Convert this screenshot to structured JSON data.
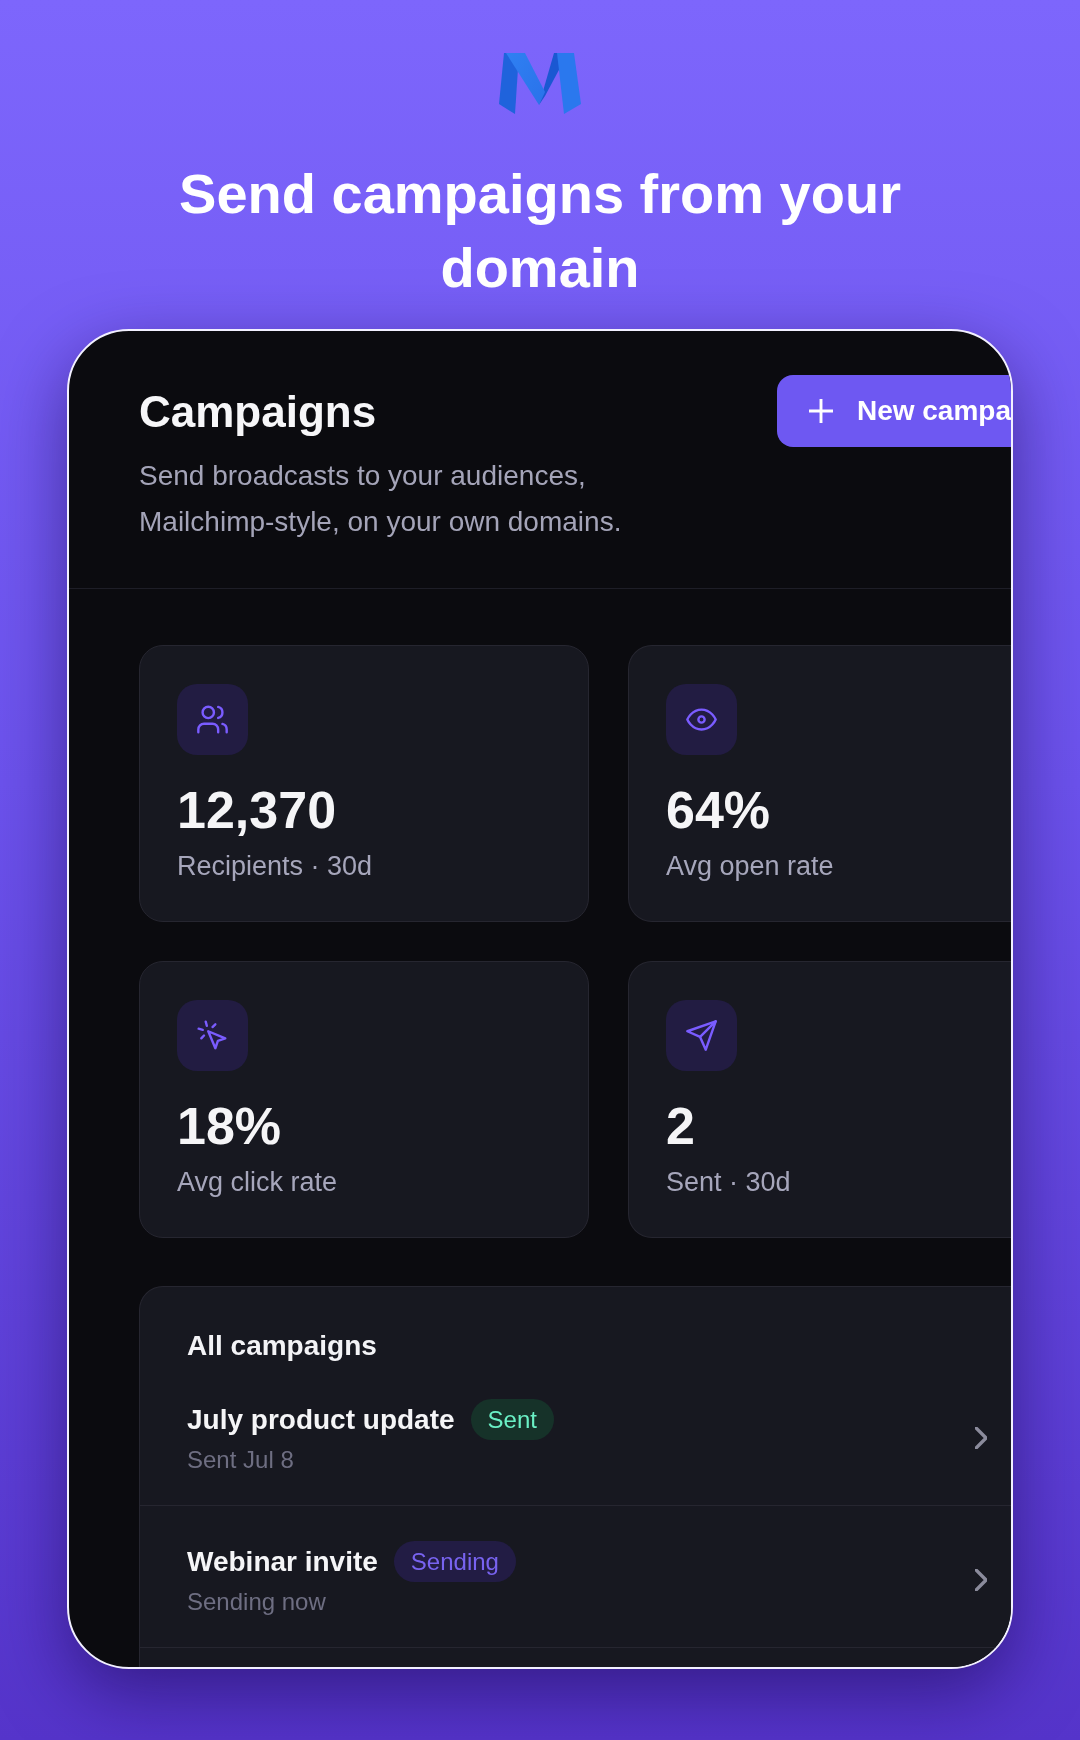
{
  "hero": {
    "title": "Send campaigns from your domain"
  },
  "header": {
    "title": "Campaigns",
    "subtitle": "Send broadcasts to your audiences, Mailchimp-style, on your own domains.",
    "action": {
      "label": "New campa"
    }
  },
  "stats": [
    {
      "kind": "audience",
      "value": "12,370",
      "label": "Recipients · 30d"
    },
    {
      "kind": "opens",
      "value": "64%",
      "label": "Avg open rate"
    },
    {
      "kind": "clicks",
      "value": "18%",
      "label": "Avg click rate"
    },
    {
      "kind": "sends",
      "value": "2",
      "label": "Sent · 30d"
    }
  ],
  "campaigns": {
    "title": "All campaigns",
    "items": [
      {
        "name": "July product update",
        "status": "Sent",
        "color": "#163229",
        "detail": "Sent Jul 8"
      },
      {
        "name": "Webinar invite",
        "status": "Sending",
        "color": "#221c44",
        "detail": "Sending now"
      }
    ]
  }
}
